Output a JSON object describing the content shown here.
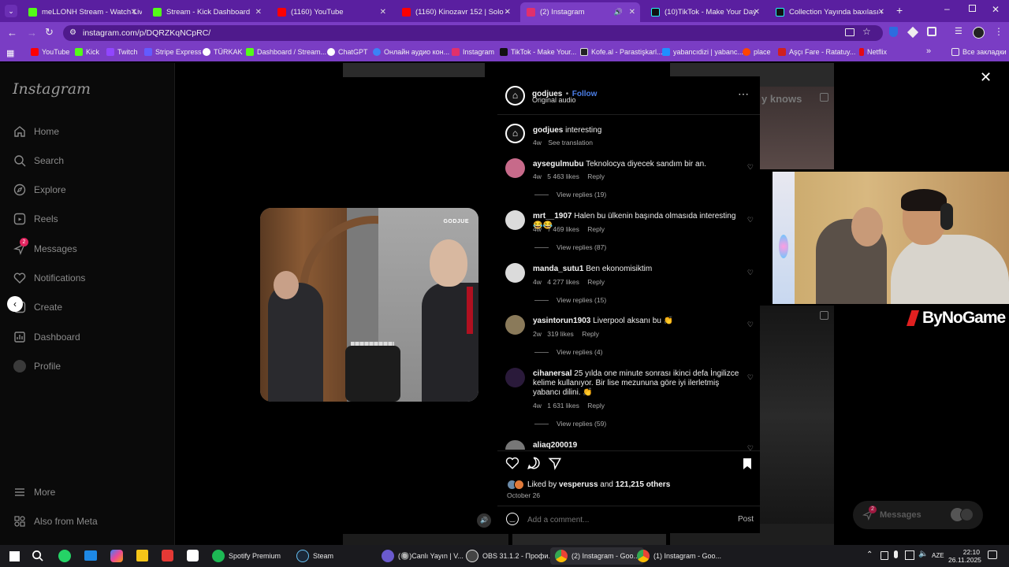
{
  "browser": {
    "tabs": [
      {
        "label": "meLLONH Stream - Watch Live",
        "color": "#53fc18"
      },
      {
        "label": "Stream - Kick Dashboard",
        "color": "#53fc18"
      },
      {
        "label": "(1160) YouTube",
        "color": "#ff0000"
      },
      {
        "label": "(1160) Kinozavr 152 | Solo - Yo",
        "color": "#ff0000"
      },
      {
        "label": "(2) Instagram",
        "color": "#e1306c"
      },
      {
        "label": "(10)TikTok - Make Your Day",
        "color": "#111111"
      },
      {
        "label": "Collection Yayında baxılası crea",
        "color": "#111111"
      }
    ],
    "url": "instagram.com/p/DQRZKqNCpRC/",
    "bookmarks": [
      {
        "label": "YouTube",
        "color": "#ff0000"
      },
      {
        "label": "Kick",
        "color": "#53fc18"
      },
      {
        "label": "Twitch",
        "color": "#9146ff"
      },
      {
        "label": "Stripe Express",
        "color": "#635bff"
      },
      {
        "label": "TÜRKAK",
        "color": "#ffffff"
      },
      {
        "label": "Dashboard / Stream...",
        "color": "#53fc18"
      },
      {
        "label": "ChatGPT",
        "color": "#ffffff"
      },
      {
        "label": "Онлайн аудио кон...",
        "color": "#3b82f6"
      },
      {
        "label": "Instagram",
        "color": "#e1306c"
      },
      {
        "label": "TikTok - Make Your...",
        "color": "#111111"
      },
      {
        "label": "Kofe.al - Parastişkarl...",
        "color": "#222222"
      },
      {
        "label": "yabancıdizi | yabanc...",
        "color": "#1e90ff"
      },
      {
        "label": "place",
        "color": "#ff4500"
      },
      {
        "label": "Aşçı Fare - Ratatuy...",
        "color": "#d02020"
      },
      {
        "label": "Netflix",
        "color": "#e50914"
      }
    ],
    "bookmarks_more": "»",
    "other_bookmarks": "Все закладки"
  },
  "instagram": {
    "logo": "Instagram",
    "nav": [
      {
        "label": "Home",
        "icon": "home-icon"
      },
      {
        "label": "Search",
        "icon": "search-icon"
      },
      {
        "label": "Explore",
        "icon": "explore-icon"
      },
      {
        "label": "Reels",
        "icon": "reels-icon"
      },
      {
        "label": "Messages",
        "icon": "messages-icon",
        "badge": "2"
      },
      {
        "label": "Notifications",
        "icon": "heart-icon"
      },
      {
        "label": "Create",
        "icon": "create-icon"
      },
      {
        "label": "Dashboard",
        "icon": "dashboard-icon"
      },
      {
        "label": "Profile",
        "icon": "profile-icon"
      }
    ],
    "more": "More",
    "meta": "Also from Meta",
    "bg_text": "y knows"
  },
  "post": {
    "author": "godjues",
    "dot": "•",
    "follow": "Follow",
    "audio": "Original audio",
    "video_watermark": "GODJUE",
    "caption": {
      "user": "godjues",
      "text": "interesting",
      "age": "4w",
      "see_translation": "See translation"
    },
    "comments": [
      {
        "user": "aysegulmubu",
        "text": "Teknolocya diyecek sandım bir an.",
        "age": "4w",
        "likes": "5 463 likes",
        "reply": "Reply",
        "replies": "View replies (19)",
        "avatar_color": "#c76a8a"
      },
      {
        "user": "mrt__1907",
        "text": "Halen bu ülkenin başında olmasıda interesting😂😂",
        "age": "4w",
        "likes": "7 469 likes",
        "reply": "Reply",
        "replies": "View replies (87)",
        "avatar_color": "#dbdbdb"
      },
      {
        "user": "manda_sutu1",
        "text": "Ben ekonomisiktim",
        "age": "4w",
        "likes": "4 277 likes",
        "reply": "Reply",
        "replies": "View replies (15)",
        "avatar_color": "#dbdbdb"
      },
      {
        "user": "yasintorun1903",
        "text": "Liverpool aksanı bu 👏",
        "age": "2w",
        "likes": "319 likes",
        "reply": "Reply",
        "replies": "View replies (4)",
        "avatar_color": "#8a7a5a"
      },
      {
        "user": "cihanersal",
        "text": "25 yılda one minute sonrası ikinci defa İngilizce kelime kullanıyor. Bir lise mezununa göre iyi ilerletmiş yabancı dilini. 👏",
        "age": "4w",
        "likes": "1 631 likes",
        "reply": "Reply",
        "replies": "View replies (59)",
        "avatar_color": "#2a1a3a"
      },
      {
        "user": "aliaq200019",
        "text": "",
        "age": "",
        "likes": "",
        "reply": "",
        "replies": "",
        "avatar_color": "#777777"
      }
    ],
    "liked_by_prefix": "Liked by",
    "liked_by_user": "vesperuss",
    "liked_by_and": "and",
    "liked_by_count": "121,215 others",
    "date": "October 26",
    "add_comment_placeholder": "Add a comment...",
    "post_button": "Post"
  },
  "overlay": {
    "brand": "ByNoGame",
    "messages": "Messages",
    "messages_badge": "2"
  },
  "taskbar": {
    "items": [
      {
        "label": "Spotify Premium",
        "color": "#1db954"
      },
      {
        "label": "Steam",
        "color": "#1b2838"
      },
      {
        "label": "(🔘)Canlı Yayın | V...",
        "color": "#6a5acd"
      },
      {
        "label": "OBS 31.1.2 - Профи...",
        "color": "#444444"
      },
      {
        "label": "(2) Instagram - Goo...",
        "color": "#4285f4"
      },
      {
        "label": "(1) Instagram - Goo...",
        "color": "#4285f4"
      }
    ],
    "lang": "AZE",
    "time": "22:10",
    "date": "26.11.2025"
  }
}
